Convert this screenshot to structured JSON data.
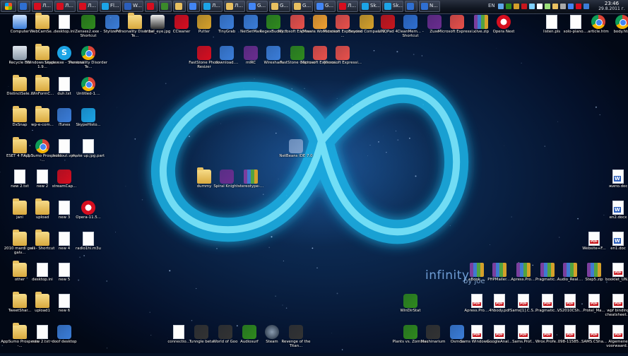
{
  "wallpaper": {
    "caption": "infinity",
    "author": "by joe",
    "colors": {
      "glow": "#39d2f6",
      "core": "#aef4ff",
      "background": "#0a2347"
    }
  },
  "taskbar": {
    "buttons": [
      {
        "label": "",
        "color": "#2f6fd1"
      },
      {
        "label": "Л...",
        "color": "#d60e1f"
      },
      {
        "label": "Л...",
        "color": "#d60e1f"
      },
      {
        "label": "Л...",
        "color": "#d60e1f"
      },
      {
        "label": "Fl...",
        "color": "#1ca4e6"
      },
      {
        "label": "W...",
        "color": "#2b5ebc"
      },
      {
        "label": "",
        "color": "#d60e1f"
      },
      {
        "label": "",
        "color": "#3b8a2a"
      },
      {
        "label": "",
        "color": "#e8c060"
      },
      {
        "label": "",
        "color": "#4285f4"
      },
      {
        "label": "Л...",
        "color": "#1ca4e6"
      },
      {
        "label": "Л...",
        "color": "#e8c060"
      },
      {
        "label": "G...",
        "color": "#4285f4"
      },
      {
        "label": "G...",
        "color": "#e8c060"
      },
      {
        "label": "G...",
        "color": "#e8c060"
      },
      {
        "label": "G...",
        "color": "#4285f4"
      },
      {
        "label": "Л...",
        "color": "#d60e1f"
      },
      {
        "label": "Sk...",
        "color": "#1ca4e6"
      },
      {
        "label": "Sk...",
        "color": "#1ca4e6"
      },
      {
        "label": "",
        "color": "#2f6fd1"
      },
      {
        "label": "N...",
        "color": "#2f6fd1"
      }
    ],
    "tray": {
      "language": "EN",
      "time": "23:46",
      "date": "29.8.2011 г."
    }
  },
  "desktop": {
    "icons": [
      {
        "label": "Computer",
        "glyph": "monitor-icon",
        "color": "#3b7dd8"
      },
      {
        "label": "WebCamSe...",
        "glyph": "folder-icon",
        "color": "#e8c060"
      },
      {
        "label": "desktop.ini",
        "glyph": "file-icon",
        "color": "#ffffff"
      },
      {
        "label": "Zenses2.exe - Shortcut",
        "glyph": "app-icon",
        "color": "#2f8a1d"
      },
      {
        "label": "Stylizer 5",
        "glyph": "app-icon",
        "color": "#3b7dd8"
      },
      {
        "label": "Personality Disorder Te...",
        "glyph": "folder-icon",
        "color": "#e8c060"
      },
      {
        "label": "tribal_eye.jpg",
        "glyph": "image-icon",
        "color": "#333333"
      },
      {
        "label": "CCleaner",
        "glyph": "app-icon",
        "color": "#d60e1f"
      },
      {
        "label": "Putter",
        "glyph": "app-icon",
        "color": "#d4a02a"
      },
      {
        "label": "TinyGrab",
        "glyph": "app-icon",
        "color": "#3b7dd8"
      },
      {
        "label": "NetSetMan",
        "glyph": "app-icon",
        "color": "#3b7dd8"
      },
      {
        "label": "RegexBuddy 3",
        "glyph": "app-icon",
        "color": "#2f8a1d"
      },
      {
        "label": "Microsoft Expressi...",
        "glyph": "app-icon",
        "color": "#e8504a"
      },
      {
        "label": "VMware Workstation",
        "glyph": "app-icon",
        "color": "#f0a030"
      },
      {
        "label": "Microsoft Expression ...",
        "glyph": "app-icon",
        "color": "#e8504a"
      },
      {
        "label": "Beyond Compare 3",
        "glyph": "app-icon",
        "color": "#d4a02a"
      },
      {
        "label": "LINQPad 4",
        "glyph": "app-icon",
        "color": "#c8161d"
      },
      {
        "label": "CleanMem... - Shortcut",
        "glyph": "app-icon",
        "color": "#2f6fd1"
      },
      {
        "label": "Zuse",
        "glyph": "app-icon",
        "color": "#6a2d8f"
      },
      {
        "label": "Microsoft Expressi...",
        "glyph": "app-icon",
        "color": "#e8504a"
      },
      {
        "label": "xlive.zip",
        "glyph": "archive-icon",
        "color": "#6a2d8f"
      },
      {
        "label": "Opera Next",
        "glyph": "opera-icon",
        "color": "#d60e1f"
      },
      {
        "label": "listen.pls",
        "glyph": "file-icon",
        "color": "#ffffff"
      },
      {
        "label": "solo-piano....",
        "glyph": "file-icon",
        "color": "#ffffff"
      },
      {
        "label": "article.htm",
        "glyph": "chrome-icon",
        "color": "#4285f4"
      },
      {
        "label": "body.htm",
        "glyph": "chrome-icon",
        "color": "#4285f4"
      },
      {
        "label": "Recycle Bin",
        "glyph": "recycle-bin-icon",
        "color": "#8a98a8"
      },
      {
        "label": "Windows Loader 1.9...",
        "glyph": "folder-icon",
        "color": "#e8c060"
      },
      {
        "label": "Skype.exe - Shortcut",
        "glyph": "skype-icon",
        "color": "#1ca4e6"
      },
      {
        "label": "Personality Disorder Te...",
        "glyph": "chrome-icon",
        "color": "#4285f4"
      },
      {
        "label": "FastStone Photo Resizer",
        "glyph": "app-icon",
        "color": "#d60e1f"
      },
      {
        "label": "download....",
        "glyph": "app-icon",
        "color": "#3b7dd8"
      },
      {
        "label": "mIRC",
        "glyph": "app-icon",
        "color": "#6a2d8f"
      },
      {
        "label": "Wireshark",
        "glyph": "app-icon",
        "color": "#3b7dd8"
      },
      {
        "label": "FastStone Capture",
        "glyph": "app-icon",
        "color": "#2f8a1d"
      },
      {
        "label": "Microsoft Expressi...",
        "glyph": "app-icon",
        "color": "#e8504a"
      },
      {
        "label": "Microsoft Expressi...",
        "glyph": "app-icon",
        "color": "#e8504a"
      },
      {
        "label": "DistinctSele...",
        "glyph": "folder-icon",
        "color": "#e8c060"
      },
      {
        "label": "WinFormC...",
        "glyph": "folder-icon",
        "color": "#e8c060"
      },
      {
        "label": "duh.txt",
        "glyph": "file-icon",
        "color": "#ffffff"
      },
      {
        "label": "Untitled-1....",
        "glyph": "chrome-icon",
        "color": "#4285f4"
      },
      {
        "label": "DxSnap",
        "glyph": "folder-icon",
        "color": "#e8c060"
      },
      {
        "label": "wp-e-com...",
        "glyph": "folder-icon",
        "color": "#e8c060"
      },
      {
        "label": "iTunes",
        "glyph": "app-icon",
        "color": "#3b7dd8"
      },
      {
        "label": "SkypeHisto...",
        "glyph": "app-icon",
        "color": "#1ca4e6"
      },
      {
        "label": "NetBeans IDE 7.0",
        "glyph": "app-icon",
        "color": "#7c9cc8"
      },
      {
        "label": "ESET 4 Fix 1.3",
        "glyph": "folder-icon",
        "color": "#e8c060"
      },
      {
        "label": "AppSumo Prospects -...",
        "glyph": "chrome-icon",
        "color": "#4285f4"
      },
      {
        "label": "holdout.vpk",
        "glyph": "file-icon",
        "color": "#ffffff"
      },
      {
        "label": "make up.jpg.part",
        "glyph": "file-icon",
        "color": "#ffffff"
      },
      {
        "label": "dummy",
        "glyph": "folder-icon",
        "color": "#e8c060"
      },
      {
        "label": "Spiral Knights",
        "glyph": "app-icon",
        "color": "#6a2d8f"
      },
      {
        "label": "stereotype-...",
        "glyph": "archive-icon",
        "color": "#6a2d8f"
      },
      {
        "label": "new 2.txt",
        "glyph": "file-icon",
        "color": "#ffffff"
      },
      {
        "label": "new 2",
        "glyph": "file-icon",
        "color": "#ffffff"
      },
      {
        "label": "streamCap...",
        "glyph": "app-icon",
        "color": "#d60e1f"
      },
      {
        "label": "жипо.doc",
        "glyph": "doc-icon",
        "color": "#2b5ebc"
      },
      {
        "label": "jani",
        "glyph": "folder-icon",
        "color": "#e8c060"
      },
      {
        "label": "upload",
        "glyph": "folder-icon",
        "color": "#e8c060"
      },
      {
        "label": "new 3",
        "glyph": "file-icon",
        "color": "#ffffff"
      },
      {
        "label": "Opera-11.5...",
        "glyph": "opera-icon",
        "color": "#d60e1f"
      },
      {
        "label": "en2.docx",
        "glyph": "doc-icon",
        "color": "#2b5ebc"
      },
      {
        "label": "2010 mardi gras galv...",
        "glyph": "folder-icon",
        "color": "#e8c060"
      },
      {
        "label": "all - Shortcut",
        "glyph": "folder-icon",
        "color": "#e8c060"
      },
      {
        "label": "new 4",
        "glyph": "file-icon",
        "color": "#ffffff"
      },
      {
        "label": "radio1hi.m3u",
        "glyph": "file-icon",
        "color": "#ffffff"
      },
      {
        "label": "Website+F...",
        "glyph": "pdf-icon",
        "color": "#c8161d"
      },
      {
        "label": "en1.doc",
        "glyph": "doc-icon",
        "color": "#2b5ebc"
      },
      {
        "label": "other",
        "glyph": "folder-icon",
        "color": "#e8c060"
      },
      {
        "label": "desktop.ini",
        "glyph": "file-icon",
        "color": "#ffffff"
      },
      {
        "label": "new 5",
        "glyph": "file-icon",
        "color": "#ffffff"
      },
      {
        "label": "eBook....",
        "glyph": "archive-icon",
        "color": "#6a2d8f"
      },
      {
        "label": "PHPMailer....",
        "glyph": "archive-icon",
        "color": "#6a2d8f"
      },
      {
        "label": "Apress.Pro....",
        "glyph": "archive-icon",
        "color": "#6a2d8f"
      },
      {
        "label": "Pragmatic....",
        "glyph": "archive-icon",
        "color": "#6a2d8f"
      },
      {
        "label": "Audio_Real....",
        "glyph": "archive-icon",
        "color": "#6a2d8f"
      },
      {
        "label": "Step5.zip",
        "glyph": "archive-icon",
        "color": "#6a2d8f"
      },
      {
        "label": "booklet_UN...",
        "glyph": "pdf-icon",
        "color": "#c8161d"
      },
      {
        "label": "TweetShar...",
        "glyph": "folder-icon",
        "color": "#e8c060"
      },
      {
        "label": "upload1",
        "glyph": "folder-icon",
        "color": "#e8c060"
      },
      {
        "label": "new 6",
        "glyph": "file-icon",
        "color": "#ffffff"
      },
      {
        "label": "WinDirStat",
        "glyph": "app-icon",
        "color": "#2f8a1d"
      },
      {
        "label": "Apress.Pro....",
        "glyph": "pdf-icon",
        "color": "#c8161d"
      },
      {
        "label": "4hbody.pdf",
        "glyph": "pdf-icon",
        "color": "#c8161d"
      },
      {
        "label": "Sams[1].C.S...",
        "glyph": "pdf-icon",
        "color": "#c8161d"
      },
      {
        "label": "Pragmatic....",
        "glyph": "pdf-icon",
        "color": "#c8161d"
      },
      {
        "label": "VS2010CSh...",
        "glyph": "pdf-icon",
        "color": "#c8161d"
      },
      {
        "label": "Protel_Ma...",
        "glyph": "pdf-icon",
        "color": "#c8161d"
      },
      {
        "label": "wpf binding cheatsheet....",
        "glyph": "pdf-icon",
        "color": "#c8161d"
      },
      {
        "label": "AppSumo Prospects -...",
        "glyph": "folder-icon",
        "color": "#e8c060"
      },
      {
        "label": "new 2.txt~",
        "glyph": "file-icon",
        "color": "#ffffff"
      },
      {
        "label": "doof desktop",
        "glyph": "app-icon",
        "color": "#3b7dd8"
      },
      {
        "label": "connectio...",
        "glyph": "file-icon",
        "color": "#ffffff"
      },
      {
        "label": "Tunngle beta",
        "glyph": "app-icon",
        "color": "#333333"
      },
      {
        "label": "World of Goo",
        "glyph": "app-icon",
        "color": "#333333"
      },
      {
        "label": "Audiosurf",
        "glyph": "app-icon",
        "color": "#2f8a1d"
      },
      {
        "label": "Steam",
        "glyph": "steam-icon",
        "color": "#1b2838"
      },
      {
        "label": "Revenge of the Titan...",
        "glyph": "app-icon",
        "color": "#333333"
      },
      {
        "label": "Plants vs. Zombies",
        "glyph": "app-icon",
        "color": "#2f8a1d"
      },
      {
        "label": "Machinarium",
        "glyph": "app-icon",
        "color": "#333333"
      },
      {
        "label": "Osmos",
        "glyph": "app-icon",
        "color": "#3b7dd8"
      },
      {
        "label": "Sams Windows ...",
        "glyph": "pdf-icon",
        "color": "#c8161d"
      },
      {
        "label": "GoogleAnal...",
        "glyph": "pdf-icon",
        "color": "#c8161d"
      },
      {
        "label": "Sams.Prof...",
        "glyph": "pdf-icon",
        "color": "#c8161d"
      },
      {
        "label": "Wrox.Profe...",
        "glyph": "pdf-icon",
        "color": "#c8161d"
      },
      {
        "label": "098-11585...",
        "glyph": "pdf-icon",
        "color": "#c8161d"
      },
      {
        "label": "SAMS.CSha...",
        "glyph": "pdf-icon",
        "color": "#c8161d"
      },
      {
        "label": "Algemene voorwaard...",
        "glyph": "pdf-icon",
        "color": "#c8161d"
      }
    ]
  }
}
